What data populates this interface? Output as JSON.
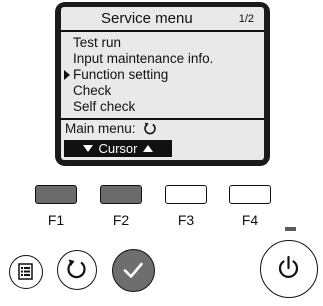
{
  "screen": {
    "title": "Service menu",
    "page": "1/2",
    "menu_items": [
      {
        "label": "Test run",
        "selected": false
      },
      {
        "label": "Input maintenance info.",
        "selected": false
      },
      {
        "label": "Function setting",
        "selected": true
      },
      {
        "label": "Check",
        "selected": false
      },
      {
        "label": "Self check",
        "selected": false
      }
    ],
    "main_menu_label": "Main menu:",
    "main_menu_icon": "return-icon",
    "cursor_label": "Cursor"
  },
  "function_keys": [
    {
      "label": "F1",
      "active": true
    },
    {
      "label": "F2",
      "active": true
    },
    {
      "label": "F3",
      "active": false
    },
    {
      "label": "F4",
      "active": false
    }
  ],
  "buttons": {
    "menu": "menu-icon",
    "return": "return-icon",
    "confirm": "check-icon",
    "power": "power-icon"
  },
  "colors": {
    "lcd_background": "#e9e9e9",
    "bezel": "#1a1a1a",
    "key_active": "#6b6b6b",
    "confirm_button": "#6e6e6e"
  }
}
